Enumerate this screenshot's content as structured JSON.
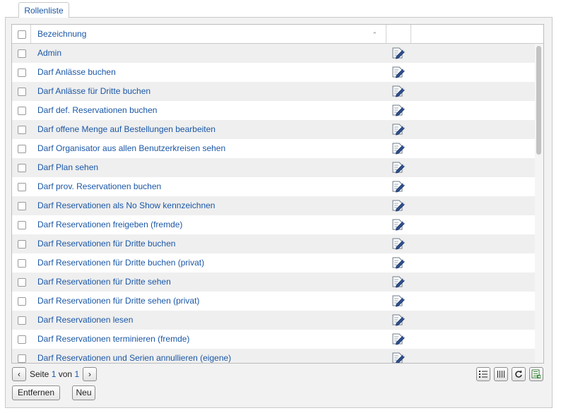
{
  "tab": {
    "label": "Rollenliste"
  },
  "grid": {
    "header": {
      "name_label": "Bezeichnung"
    },
    "rows": [
      {
        "label": "Admin"
      },
      {
        "label": "Darf Anlässe buchen"
      },
      {
        "label": "Darf Anlässe für Dritte buchen"
      },
      {
        "label": "Darf def. Reservationen buchen"
      },
      {
        "label": "Darf offene Menge auf Bestellungen bearbeiten"
      },
      {
        "label": "Darf Organisator aus allen Benutzerkreisen sehen"
      },
      {
        "label": "Darf Plan sehen"
      },
      {
        "label": "Darf prov. Reservationen buchen"
      },
      {
        "label": "Darf Reservationen als No Show kennzeichnen"
      },
      {
        "label": "Darf Reservationen freigeben (fremde)"
      },
      {
        "label": "Darf Reservationen für Dritte buchen"
      },
      {
        "label": "Darf Reservationen für Dritte buchen (privat)"
      },
      {
        "label": "Darf Reservationen für Dritte sehen"
      },
      {
        "label": "Darf Reservationen für Dritte sehen (privat)"
      },
      {
        "label": "Darf Reservationen lesen"
      },
      {
        "label": "Darf Reservationen terminieren (fremde)"
      },
      {
        "label": "Darf Reservationen und Serien annullieren (eigene)"
      }
    ]
  },
  "pager": {
    "page_label": "Seite",
    "current_page": "1",
    "of_label": "von",
    "total_pages": "1"
  },
  "actions": {
    "remove_label": "Entfernen",
    "new_label": "Neu"
  },
  "colors": {
    "link": "#1a57a6",
    "row_alt": "#efefef"
  }
}
